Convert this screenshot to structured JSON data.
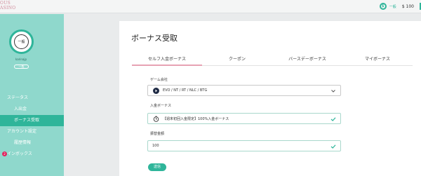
{
  "app": {
    "logo_line1": "OUS",
    "logo_line2": "ASINO"
  },
  "topbar": {
    "rank_label": "一般",
    "balance": "$ 100"
  },
  "profile": {
    "avatar_text": "一般",
    "username": "karinajp",
    "rank_badge": "一般"
  },
  "sidebar": {
    "items": [
      {
        "label": "ステータス",
        "sub": false,
        "active": false
      },
      {
        "label": "入出金",
        "sub": true,
        "active": false
      },
      {
        "label": "ボーナス受取",
        "sub": true,
        "active": true
      },
      {
        "label": "アカウント設定",
        "sub": false,
        "active": false
      },
      {
        "label": "履歴情報",
        "sub": true,
        "active": false
      },
      {
        "label": "インボックス",
        "sub": false,
        "active": false,
        "badge": "2"
      }
    ]
  },
  "main": {
    "title": "ボーナス受取",
    "tabs": [
      "セルフ入金ボーナス",
      "クーポン",
      "バースデーボーナス",
      "マイボーナス"
    ],
    "active_tab": 0,
    "game_company": {
      "label": "ゲーム会社",
      "value": "EVO / NT / RT / NLC / BTG"
    },
    "deposit_bonus": {
      "label": "入金ボーナス",
      "value": "【週末初回入金限定】100%入金ボーナス"
    },
    "deposit_amount": {
      "label": "振替金額",
      "value": "100"
    },
    "submit_label": "送信"
  },
  "colors": {
    "accent": "#2fb59a",
    "sidebar": "#8fd8cc",
    "tab_active": "#e7a2b3",
    "badge": "#e0245e"
  }
}
